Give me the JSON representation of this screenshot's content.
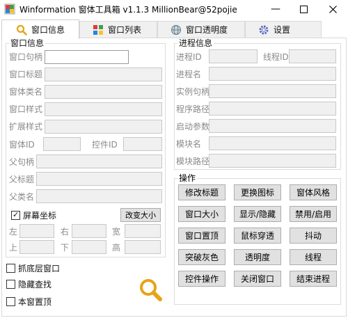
{
  "window": {
    "title": "Winformation 窗体工具箱 v1.1.3  MillionBear@52pojie"
  },
  "tabs": [
    {
      "label": "窗口信息",
      "icon": "search-icon"
    },
    {
      "label": "窗口列表",
      "icon": "grid-icon"
    },
    {
      "label": "窗口透明度",
      "icon": "globe-icon"
    },
    {
      "label": "设置",
      "icon": "gear-icon"
    }
  ],
  "window_info": {
    "group_title": "窗口信息",
    "fields": {
      "handle": "窗口句柄",
      "title": "窗口标题",
      "class_name": "窗体类名",
      "style": "窗口样式",
      "ex_style": "扩展样式",
      "window_id": "窗体ID",
      "control_id": "控件ID",
      "parent_handle": "父句柄",
      "parent_title": "父标题",
      "parent_class": "父类名"
    },
    "screen_coords_label": "屏幕坐标",
    "resize_button": "改变大小",
    "pos": {
      "left": "左",
      "right": "右",
      "width": "宽",
      "top": "上",
      "bottom": "下",
      "height": "高"
    }
  },
  "process_info": {
    "group_title": "进程信息",
    "fields": {
      "process_id": "进程ID",
      "thread_id": "线程ID",
      "process_name": "进程名",
      "instance_handle": "实例句柄",
      "program_path": "程序路径",
      "launch_args": "启动参数",
      "module_name": "模块名",
      "module_path": "模块路径"
    }
  },
  "operations": {
    "group_title": "操作",
    "buttons": [
      "修改标题",
      "更换图标",
      "窗体风格",
      "窗口大小",
      "显示/隐藏",
      "禁用/启用",
      "窗口置顶",
      "鼠标穿透",
      "抖动",
      "突破灰色",
      "透明度",
      "线程",
      "控件操作",
      "关闭窗口",
      "结束进程"
    ]
  },
  "options": {
    "capture_bottom": "抓底层窗口",
    "hide_finder": "隐藏查找",
    "topmost": "本窗置顶"
  },
  "colors": {
    "accent": "#e8a317"
  }
}
